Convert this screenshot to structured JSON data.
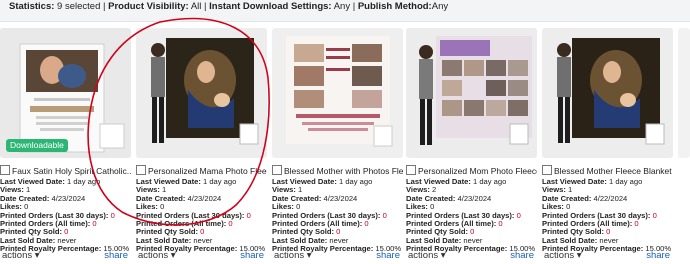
{
  "stats": {
    "statistics_label": "Statistics:",
    "statistics_value": "9 selected",
    "visibility_label": "Product Visibility:",
    "visibility_value": "All",
    "download_label": "Instant Download Settings:",
    "download_value": "Any",
    "method_label": "Publish Method:",
    "method_value": "Any",
    "separator": "|"
  },
  "labels": {
    "last_viewed": "Last Viewed Date:",
    "views": "Views:",
    "created": "Date Created:",
    "likes": "Likes:",
    "printed_30": "Printed Orders (Last 30 days):",
    "printed_all": "Printed Orders (All time):",
    "printed_qty": "Printed Qty Sold:",
    "last_sold": "Last Sold Date:",
    "royalty": "Printed Royalty Percentage:",
    "actions": "actions",
    "share": "share",
    "dropdown": "▾",
    "badge": "Downloadable"
  },
  "colors": {
    "zero_value": "#d0021b",
    "share_link": "#1a5fb4",
    "downloadable_badge": "#2bb673",
    "annotation_circle": "#d0021b"
  },
  "products": [
    {
      "title": "Faux Satin Holy Spirit Catholic...",
      "image": "baptism-invitation-card",
      "downloadable": true,
      "last_viewed": "1 day ago",
      "views": "1",
      "created": "4/23/2024",
      "likes": "0",
      "printed_30": "0",
      "printed_all": "0",
      "printed_qty": "0",
      "last_sold": "never",
      "royalty": "15.00%"
    },
    {
      "title": "Personalized Mama Photo Fleece...",
      "image": "mother-madonna-fleece-blanket",
      "downloadable": false,
      "last_viewed": "1 day ago",
      "views": "1",
      "created": "4/23/2024",
      "likes": "0",
      "printed_30": "0",
      "printed_all": "0",
      "printed_qty": "0",
      "last_sold": "never",
      "royalty": "15.00%"
    },
    {
      "title": "Blessed Mother with Photos Fleece...",
      "image": "a-mother-is-such-a-blessing-blanket",
      "downloadable": false,
      "last_viewed": "1 day ago",
      "views": "1",
      "created": "4/23/2024",
      "likes": "0",
      "printed_30": "0",
      "printed_all": "0",
      "printed_qty": "0",
      "last_sold": "never",
      "royalty": "15.00%"
    },
    {
      "title": "Personalized Mom Photo Fleece...",
      "image": "mom-photo-collage-blanket",
      "downloadable": false,
      "last_viewed": "1 day ago",
      "views": "2",
      "created": "4/23/2024",
      "likes": "0",
      "printed_30": "0",
      "printed_all": "0",
      "printed_qty": "0",
      "last_sold": "never",
      "royalty": "15.00%"
    },
    {
      "title": "Blessed Mother Fleece Blanket",
      "image": "blessed-mother-fleece-blanket",
      "downloadable": false,
      "last_viewed": "1 day ago",
      "views": "1",
      "created": "4/22/2024",
      "likes": "0",
      "printed_30": "0",
      "printed_all": "0",
      "printed_qty": "0",
      "last_sold": "never",
      "royalty": "15.00%"
    }
  ]
}
